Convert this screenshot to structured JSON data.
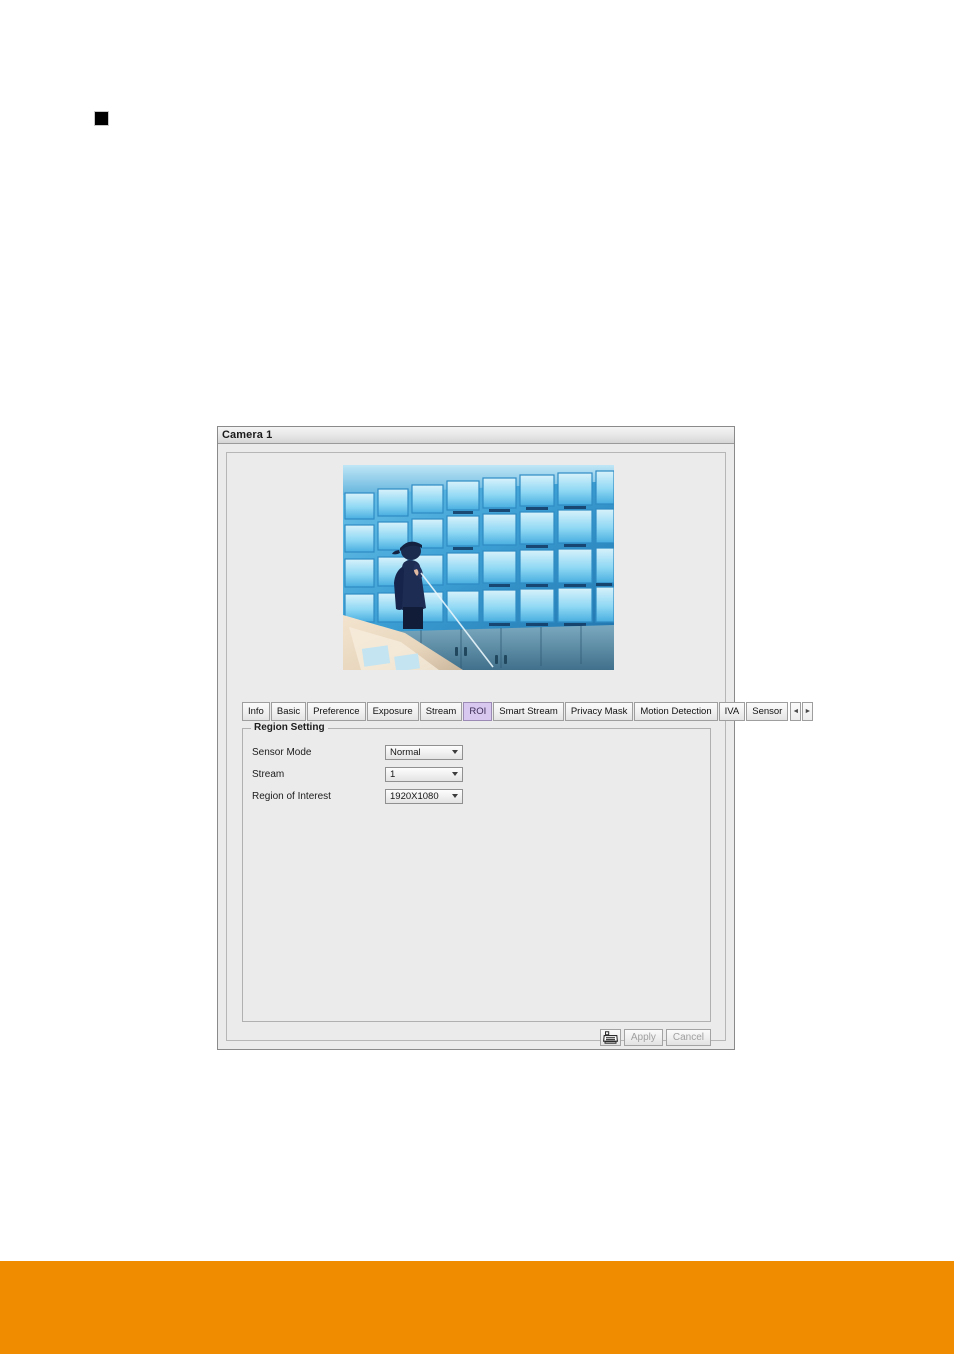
{
  "page": {
    "bullet_marker": "black-square-bullet",
    "footer_band_color": "#f08c00",
    "background_color": "#ffffff"
  },
  "dialog": {
    "title": "Camera 1",
    "preview": {
      "alt": "control-room-monitor-wall-preview",
      "description": "Blue-toned control room with wall of CCTV monitors and an operator in dark jacket and cap"
    },
    "tabs": [
      {
        "label": "Info",
        "selected": false
      },
      {
        "label": "Basic",
        "selected": false
      },
      {
        "label": "Preference",
        "selected": false
      },
      {
        "label": "Exposure",
        "selected": false
      },
      {
        "label": "Stream",
        "selected": false
      },
      {
        "label": "ROI",
        "selected": true
      },
      {
        "label": "Smart Stream",
        "selected": false
      },
      {
        "label": "Privacy Mask",
        "selected": false
      },
      {
        "label": "Motion Detection",
        "selected": false
      },
      {
        "label": "IVA",
        "selected": false
      },
      {
        "label": "Sensor",
        "selected": false
      }
    ],
    "tab_scroll": {
      "prev_icon": "chevron-left-icon",
      "prev_glyph": "◄",
      "next_icon": "chevron-right-icon",
      "next_glyph": "►"
    },
    "group": {
      "legend": "Region Setting",
      "fields": [
        {
          "label": "Sensor Mode",
          "value": "Normal",
          "name": "sensor-mode"
        },
        {
          "label": "Stream",
          "value": "1",
          "name": "stream"
        },
        {
          "label": "Region of Interest",
          "value": "1920X1080",
          "name": "region-of-interest"
        }
      ]
    },
    "buttons": {
      "save_icon": "save-icon",
      "apply_label": "Apply",
      "cancel_label": "Cancel",
      "apply_enabled": false,
      "cancel_enabled": false
    },
    "colors": {
      "selected_tab": "#d8c8ef",
      "dialog_face": "#ebebeb",
      "border": "#b0b0b0"
    }
  }
}
